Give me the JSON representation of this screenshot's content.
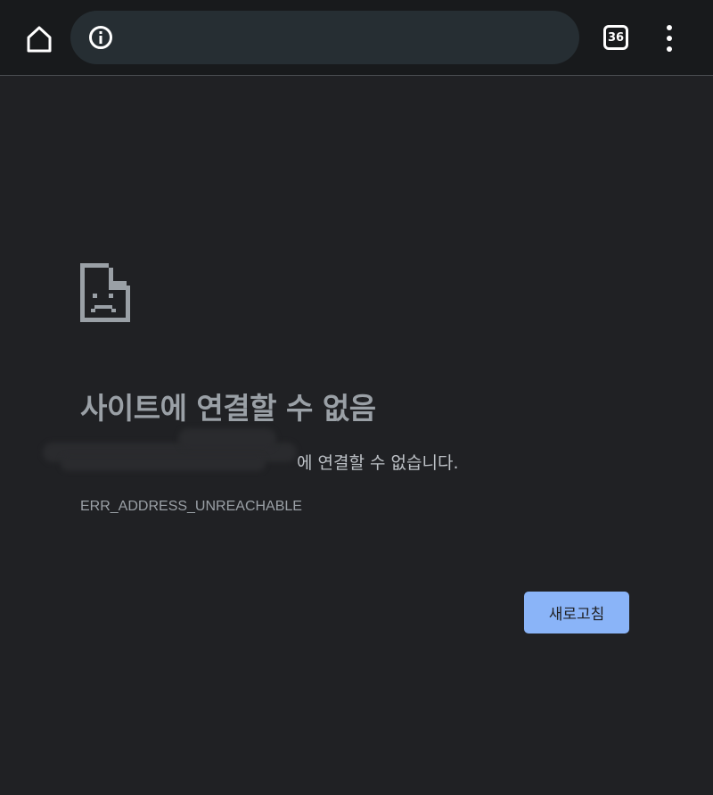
{
  "toolbar": {
    "home_icon": "home-icon",
    "info_icon": "info-icon",
    "url": "",
    "tab_count": "36",
    "menu_icon": "more-vert-icon"
  },
  "error_page": {
    "icon": "sad-page-icon",
    "title": "사이트에 연결할 수 없음",
    "description": "에 연결할 수 없습니다.",
    "error_code": "ERR_ADDRESS_UNREACHABLE",
    "reload_label": "새로고침"
  },
  "colors": {
    "background": "#202124",
    "toolbar": "#181a1c",
    "omnibox": "#262e33",
    "accent": "#8ab4f8",
    "title_text": "#9aa0a6",
    "body_text": "#bdc1c6"
  }
}
